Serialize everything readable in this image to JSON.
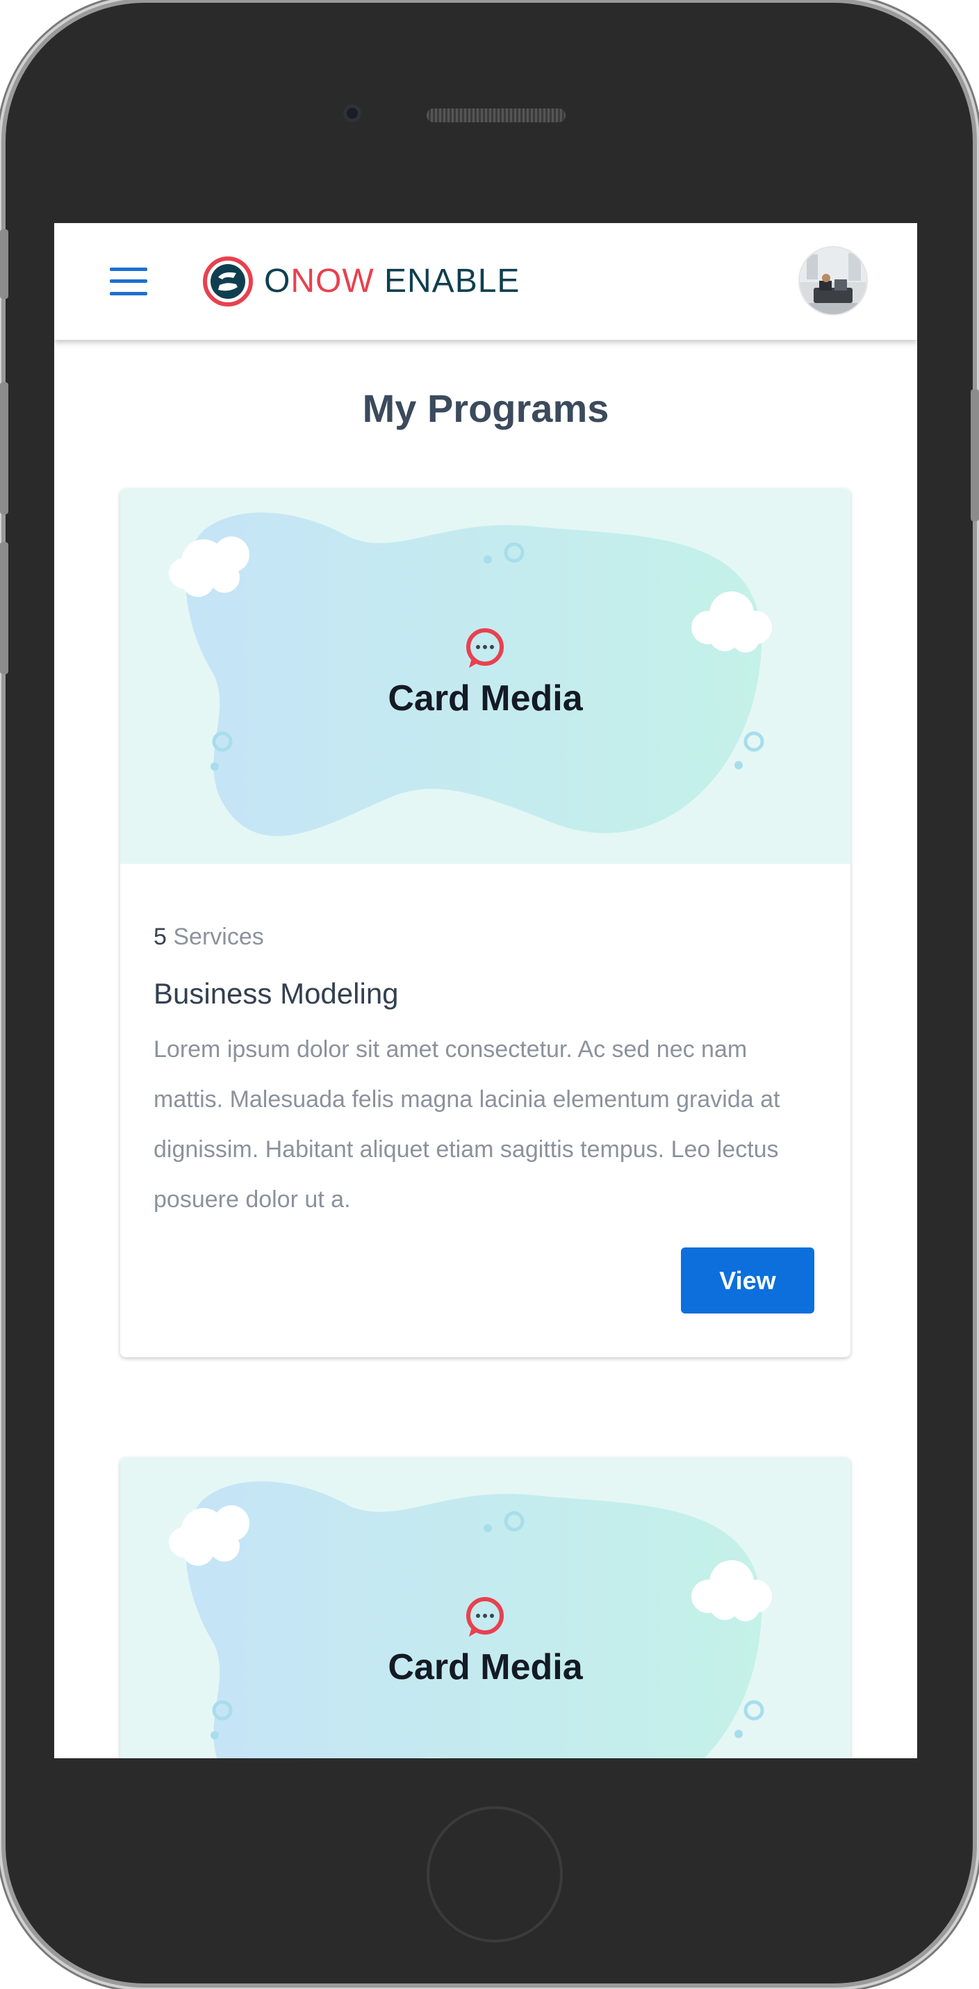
{
  "header": {
    "logo_text_part1": "O",
    "logo_text_part2": "NOW",
    "logo_text_part3": " ENABLE",
    "colors": {
      "logo_dark": "#0f3f4f",
      "logo_red": "#e8414f",
      "menu_blue": "#1f6fd0"
    }
  },
  "page": {
    "title": "My Programs"
  },
  "cards": [
    {
      "media_label": "Card Media",
      "services_count": "5",
      "services_label": " Services",
      "title": "Business Modeling",
      "description": "Lorem ipsum dolor sit amet consectetur. Ac sed nec nam mattis. Malesuada felis magna lacinia elementum gravida at dignissim. Habitant aliquet etiam sagittis tempus. Leo lectus posuere dolor ut a.",
      "button_label": "View"
    },
    {
      "media_label": "Card Media"
    }
  ],
  "colors": {
    "accent": "#0c6fdc",
    "media_bg": "#e4f7f5"
  }
}
